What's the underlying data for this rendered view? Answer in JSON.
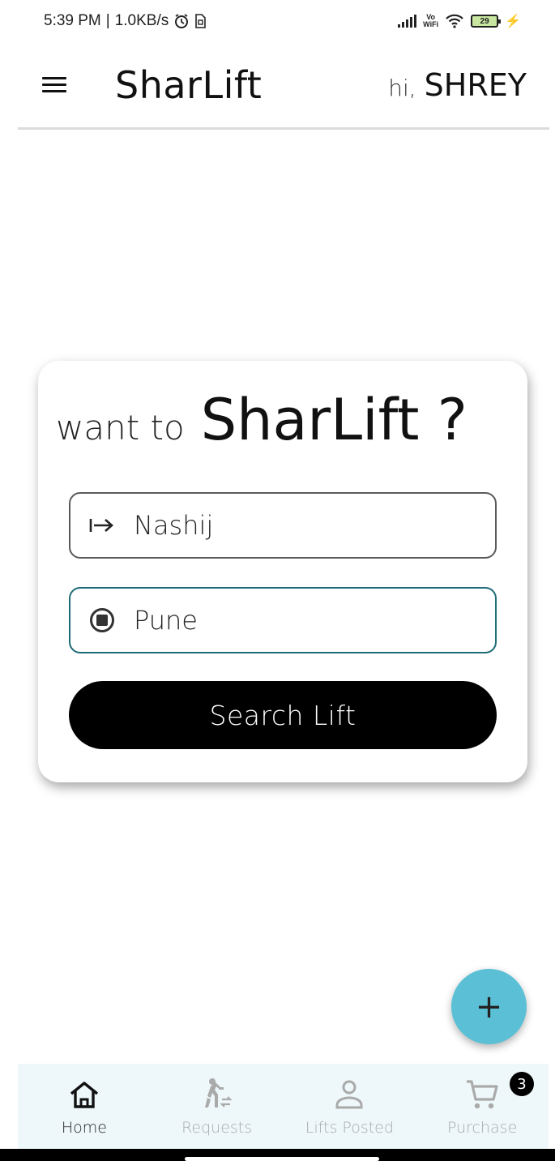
{
  "status_bar": {
    "time": "5:39 PM",
    "speed": "1.0KB/s",
    "alarm_icon": "alarm-icon",
    "sim_icon": "sim-icon",
    "vowifi": "Vo\nWiFi",
    "battery": "29"
  },
  "app_bar": {
    "title": "SharLift",
    "greeting_hi": "hi,",
    "user_name": "SHREY",
    "menu_icon": "hamburger-menu-icon"
  },
  "card": {
    "heading_want": "want to",
    "heading_brand": "SharLift ?",
    "from": {
      "value": "Nashij",
      "icon": "arrow-right-to-icon"
    },
    "to": {
      "value": "Pune",
      "icon": "radio-stop-icon"
    },
    "search_button": "Search Lift"
  },
  "fab": {
    "label": "+"
  },
  "bottom_nav": {
    "items": [
      {
        "label": "Home",
        "icon": "home-icon",
        "active": true
      },
      {
        "label": "Requests",
        "icon": "walking-transfer-icon",
        "active": false
      },
      {
        "label": "Lifts Posted",
        "icon": "person-icon",
        "active": false
      },
      {
        "label": "Purchase",
        "icon": "cart-icon",
        "active": false,
        "badge": "3"
      }
    ]
  },
  "colors": {
    "accent": "#5bc0d6",
    "focus_border": "#1f6b78",
    "nav_background": "#eef8fa",
    "button": "#000000"
  }
}
